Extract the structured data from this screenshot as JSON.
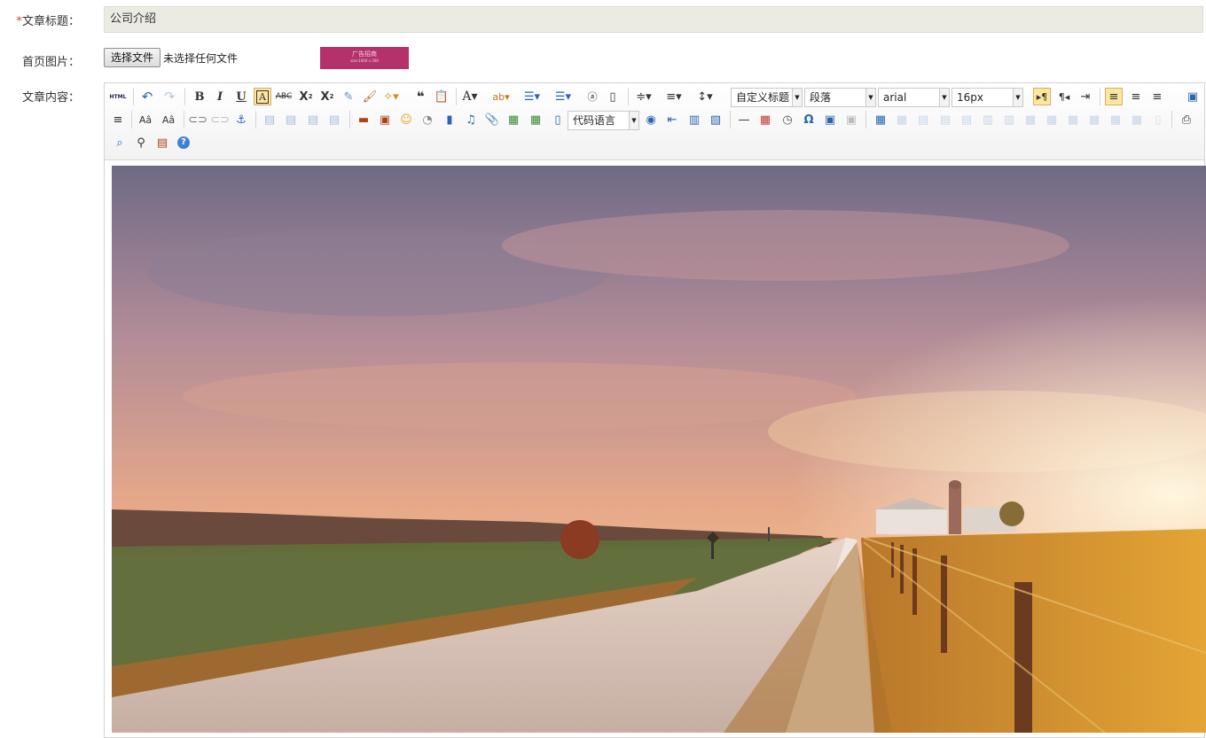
{
  "form": {
    "title_label": "文章标题：",
    "title_required": "*",
    "title_value": "公司介绍",
    "image_label": "首页图片：",
    "file_button": "选择文件",
    "file_status": "未选择任何文件",
    "thumb_text_1": "广告招商",
    "thumb_text_2": "size:1000 x 300",
    "content_label": "文章内容："
  },
  "editor": {
    "html_label": "HTML",
    "custom_heading": "自定义标题",
    "paragraph": "段落",
    "font_family": "arial",
    "font_size": "16px",
    "code_lang": "代码语言"
  }
}
